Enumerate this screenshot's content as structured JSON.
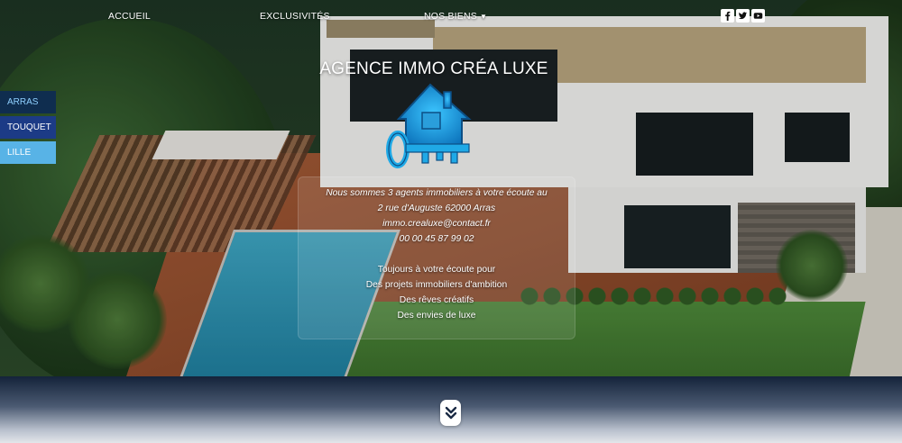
{
  "nav": {
    "home_label": "ACCUEIL",
    "exclusives_label": "EXCLUSIVITÉS",
    "properties_label": "NOS BIENS",
    "properties_caret": "▼"
  },
  "social": {
    "icons": [
      "facebook-icon",
      "twitter-icon",
      "youtube-icon"
    ]
  },
  "cities": [
    {
      "label": "ARRAS",
      "color": "#0f2d4f",
      "text_color": "#8fd0ff"
    },
    {
      "label": "TOUQUET",
      "color": "#1c3b86",
      "text_color": "#ffffff"
    },
    {
      "label": "LILLE",
      "color": "#58b3e6",
      "text_color": "#ffffff"
    }
  ],
  "agency": {
    "title": "AGENCE IMMO CRÉA LUXE",
    "logo_icon": "house-key-logo-icon",
    "logo_color": "#1fa9e6"
  },
  "contact": {
    "intro": "Nous sommes 3 agents immobiliers à votre écoute au",
    "address": "2 rue d'Auguste 62000 Arras",
    "email": "immo.crealuxe@contact.fr",
    "phone": "00 00 45 87 99 02"
  },
  "promises": [
    "Toujours à votre écoute pour",
    "Des projets immobiliers d'ambition",
    "Des rêves créatifs",
    "Des envies de luxe"
  ],
  "scroll": {
    "icon": "double-chevron-down-icon"
  }
}
